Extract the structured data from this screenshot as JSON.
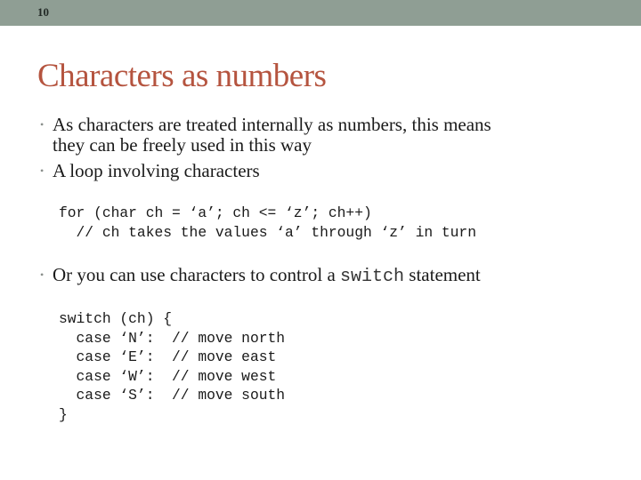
{
  "slide": {
    "number": "10",
    "title": "Characters as numbers",
    "bullets": [
      {
        "line1": "As characters are treated internally as numbers, this means",
        "line2": "they can be freely used in this way"
      },
      {
        "text": "A loop involving characters"
      },
      {
        "before": "Or you can use characters to control a ",
        "code": "switch",
        "after": " statement"
      }
    ],
    "bullet_glyph": "•",
    "loop_code": [
      "for (char ch = ‘a’; ch <= ‘z’; ch++)",
      "  // ch takes the values ‘a’ through ‘z’ in turn"
    ],
    "switch_code": [
      "switch (ch) {",
      "  case ‘N’:  // move north",
      "  case ‘E’:  // move east",
      "  case ‘W’:  // move west",
      "  case ‘S’:  // move south",
      "}"
    ]
  },
  "colors": {
    "header_bar": "#8f9e94",
    "title": "#b5543f",
    "bullet": "#8a8f8c"
  }
}
